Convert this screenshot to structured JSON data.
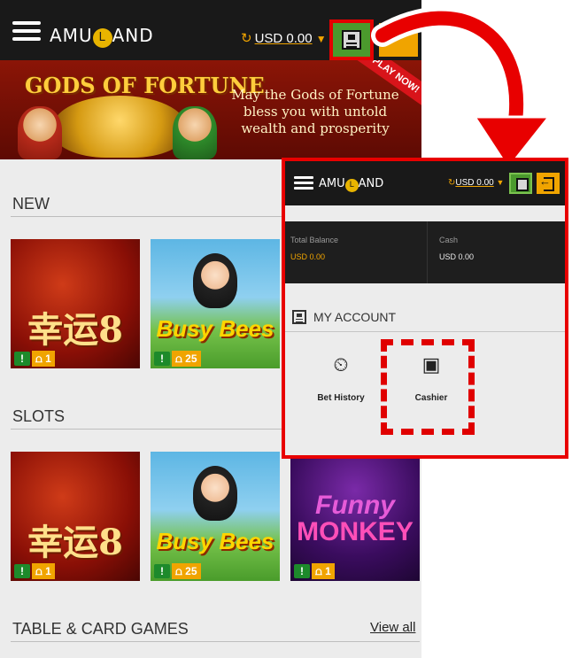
{
  "header": {
    "logo": "AMULAND",
    "logo_mark": "L",
    "refresh_icon": "refresh-icon",
    "balance": "USD 0.00",
    "dropdown_caret": "▼",
    "account_icon": "account-icon"
  },
  "banner": {
    "title": "GODS OF FORTUNE",
    "tagline": "May the Gods of Fortune bless you with untold wealth and prosperity",
    "ribbon": "PLAY NOW!"
  },
  "sections": {
    "new": "NEW",
    "slots": "SLOTS",
    "table_card": "TABLE & CARD GAMES",
    "view_all": "View all"
  },
  "games": {
    "lucky": {
      "title": "幸运8",
      "lines": "1"
    },
    "busy": {
      "title": "Busy Bees",
      "lines": "25"
    },
    "funny": {
      "title": "Funny",
      "title2": "MONKEY",
      "lines": "1"
    }
  },
  "panel": {
    "logo": "AMULAND",
    "logo_mark": "L",
    "balance": "USD 0.00",
    "total_balance_label": "Total Balance",
    "total_balance_value": "USD 0.00",
    "cash_label": "Cash",
    "cash_value": "USD 0.00",
    "my_account": "MY ACCOUNT",
    "bet_history": "Bet History",
    "cashier": "Cashier"
  },
  "colors": {
    "accent": "#f0a400",
    "highlight": "#e80000",
    "account_green": "#4b9a2d",
    "topbar": "#191919"
  }
}
